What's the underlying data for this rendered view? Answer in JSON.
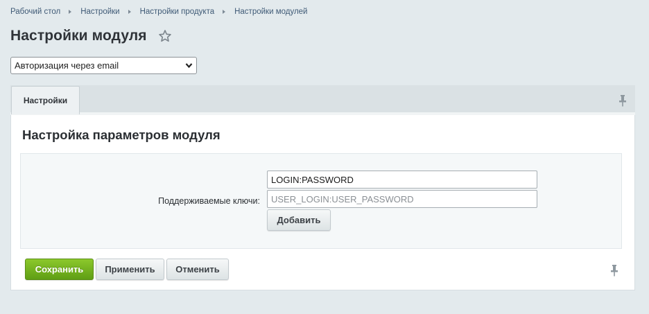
{
  "breadcrumb": {
    "items": [
      "Рабочий стол",
      "Настройки",
      "Настройки продукта",
      "Настройки модулей"
    ]
  },
  "page": {
    "title": "Настройки модуля",
    "favorite_icon": "star-outline-icon"
  },
  "module_select": {
    "selected": "Авторизация через email"
  },
  "tabs": [
    {
      "label": "Настройки",
      "active": true
    }
  ],
  "pin_icon": "pin-icon",
  "section": {
    "title": "Настройка параметров модуля",
    "field_label": "Поддерживаемые ключи:",
    "inputs": [
      {
        "value": "LOGIN:PASSWORD",
        "placeholder": ""
      },
      {
        "value": "",
        "placeholder": "USER_LOGIN:USER_PASSWORD"
      }
    ],
    "add_label": "Добавить"
  },
  "actions": {
    "save_label": "Сохранить",
    "apply_label": "Применить",
    "cancel_label": "Отменить"
  },
  "colors": {
    "background": "#e3eaed",
    "link": "#3f5a76",
    "save_button": "#6faf1c"
  }
}
